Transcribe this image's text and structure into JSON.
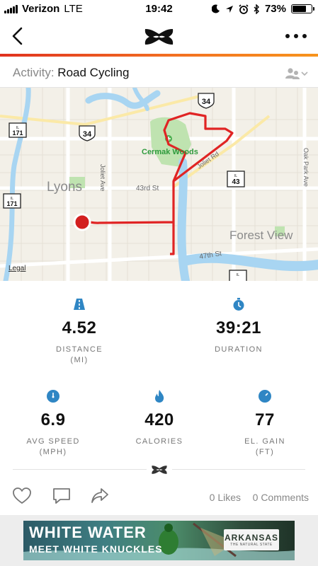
{
  "status_bar": {
    "carrier": "Verizon",
    "network": "LTE",
    "time": "19:42",
    "battery": "73%",
    "battery_level": 0.73
  },
  "activity": {
    "label": "Activity:",
    "value": "Road Cycling"
  },
  "map": {
    "labels": {
      "lyons": "Lyons",
      "forest_view": "Forest View",
      "cermak": "Cermak Woods",
      "st43": "43rd St",
      "st47": "47th St",
      "joliet_ave": "Joliet Ave",
      "joliet_rd": "Joliet Rd",
      "oak_park": "Oak Park Ave",
      "legal": "Legal"
    },
    "shields": {
      "us34_top": "34",
      "us34_left": "34",
      "il171_top": "171",
      "il171_mid": "171",
      "il43": "43",
      "il_prefix": "IL",
      "il_bottom": "IL"
    }
  },
  "stats": {
    "distance": {
      "value": "4.52",
      "label": "DISTANCE",
      "unit": "(MI)"
    },
    "duration": {
      "value": "39:21",
      "label": "DURATION"
    },
    "avg_speed": {
      "value": "6.9",
      "label": "AVG SPEED",
      "unit": "(MPH)"
    },
    "calories": {
      "value": "420",
      "label": "CALORIES"
    },
    "el_gain": {
      "value": "77",
      "label": "EL. GAIN",
      "unit": "(FT)"
    }
  },
  "social": {
    "likes": "0 Likes",
    "comments": "0 Comments"
  },
  "ad": {
    "headline": "WHITE WATER",
    "subline": "MEET WHITE KNUCKLES",
    "brand": "ARKANSAS",
    "brand_tag": "THE NATURAL STATE"
  },
  "colors": {
    "accent": "#2f86c4",
    "route": "#e02424",
    "water": "#a8d5f2",
    "park": "#bfe3b0"
  }
}
